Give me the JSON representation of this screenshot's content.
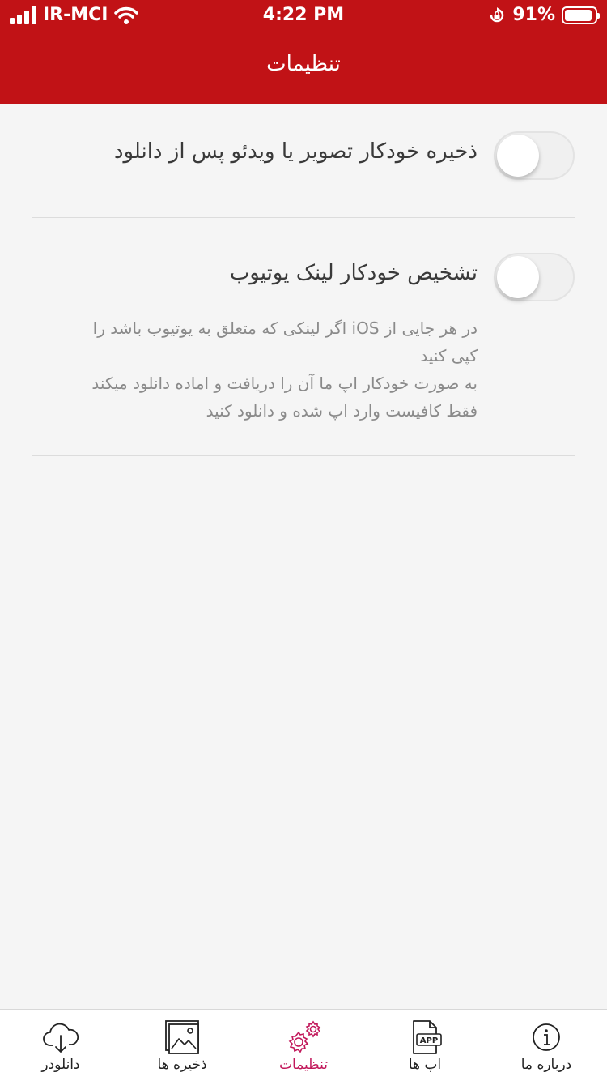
{
  "status_bar": {
    "carrier": "IR-MCI",
    "time": "4:22 PM",
    "battery": "91%",
    "battery_level": 0.91
  },
  "nav": {
    "title": "تنظیمات"
  },
  "settings": {
    "auto_save": {
      "label": "ذخیره خودکار تصویر یا ویدئو پس از دانلود",
      "enabled": false
    },
    "youtube_detect": {
      "label": "تشخیص خودکار لینک یوتیوب",
      "enabled": false,
      "description": [
        "در هر جایی از iOS اگر لینکی که متعلق به یوتیوب باشد را",
        "کپی کنید",
        "به صورت خودکار اپ ما آن را دریافت و اماده دانلود میکند",
        "فقط کافیست وارد اپ شده و دانلود کنید"
      ]
    }
  },
  "tabs": [
    {
      "label": "دانلودر",
      "icon": "cloud-download-icon"
    },
    {
      "label": "ذخیره ها",
      "icon": "gallery-icon"
    },
    {
      "label": "تنظیمات",
      "icon": "gears-icon",
      "active": true
    },
    {
      "label": "اپ ها",
      "icon": "app-file-icon"
    },
    {
      "label": "درباره ما",
      "icon": "info-icon"
    }
  ],
  "colors": {
    "header": "#c11216",
    "active_tab": "#c2185b",
    "background": "#f5f5f5"
  }
}
